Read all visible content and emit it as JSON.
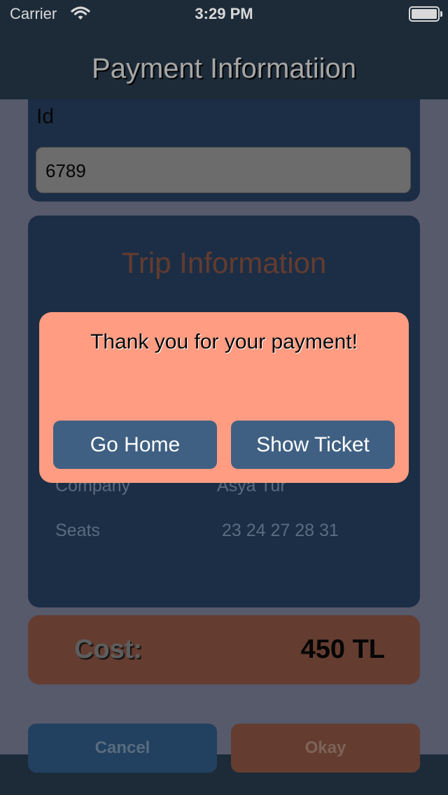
{
  "status_bar": {
    "carrier": "Carrier",
    "time": "3:29 PM"
  },
  "nav": {
    "title": "Payment Informatiion"
  },
  "id_section": {
    "label": "Id",
    "value": "6789"
  },
  "trip": {
    "title": "Trip Information",
    "rows": [
      {
        "label": "Company",
        "value": "Asya Tur"
      },
      {
        "label": "Seats",
        "value": "23 24 27 28 31"
      }
    ]
  },
  "cost": {
    "label": "Cost:",
    "value": "450 TL"
  },
  "buttons": {
    "cancel": "Cancel",
    "okay": "Okay"
  },
  "alert": {
    "message": "Thank you for your payment!",
    "go_home": "Go Home",
    "show_ticket": "Show Ticket"
  },
  "colors": {
    "nav_bg": "#1d2b39",
    "card_bg": "#1c2e45",
    "accent_orange": "#643d30",
    "alert_bg": "#ff9c82",
    "alert_button": "#3f6082"
  }
}
